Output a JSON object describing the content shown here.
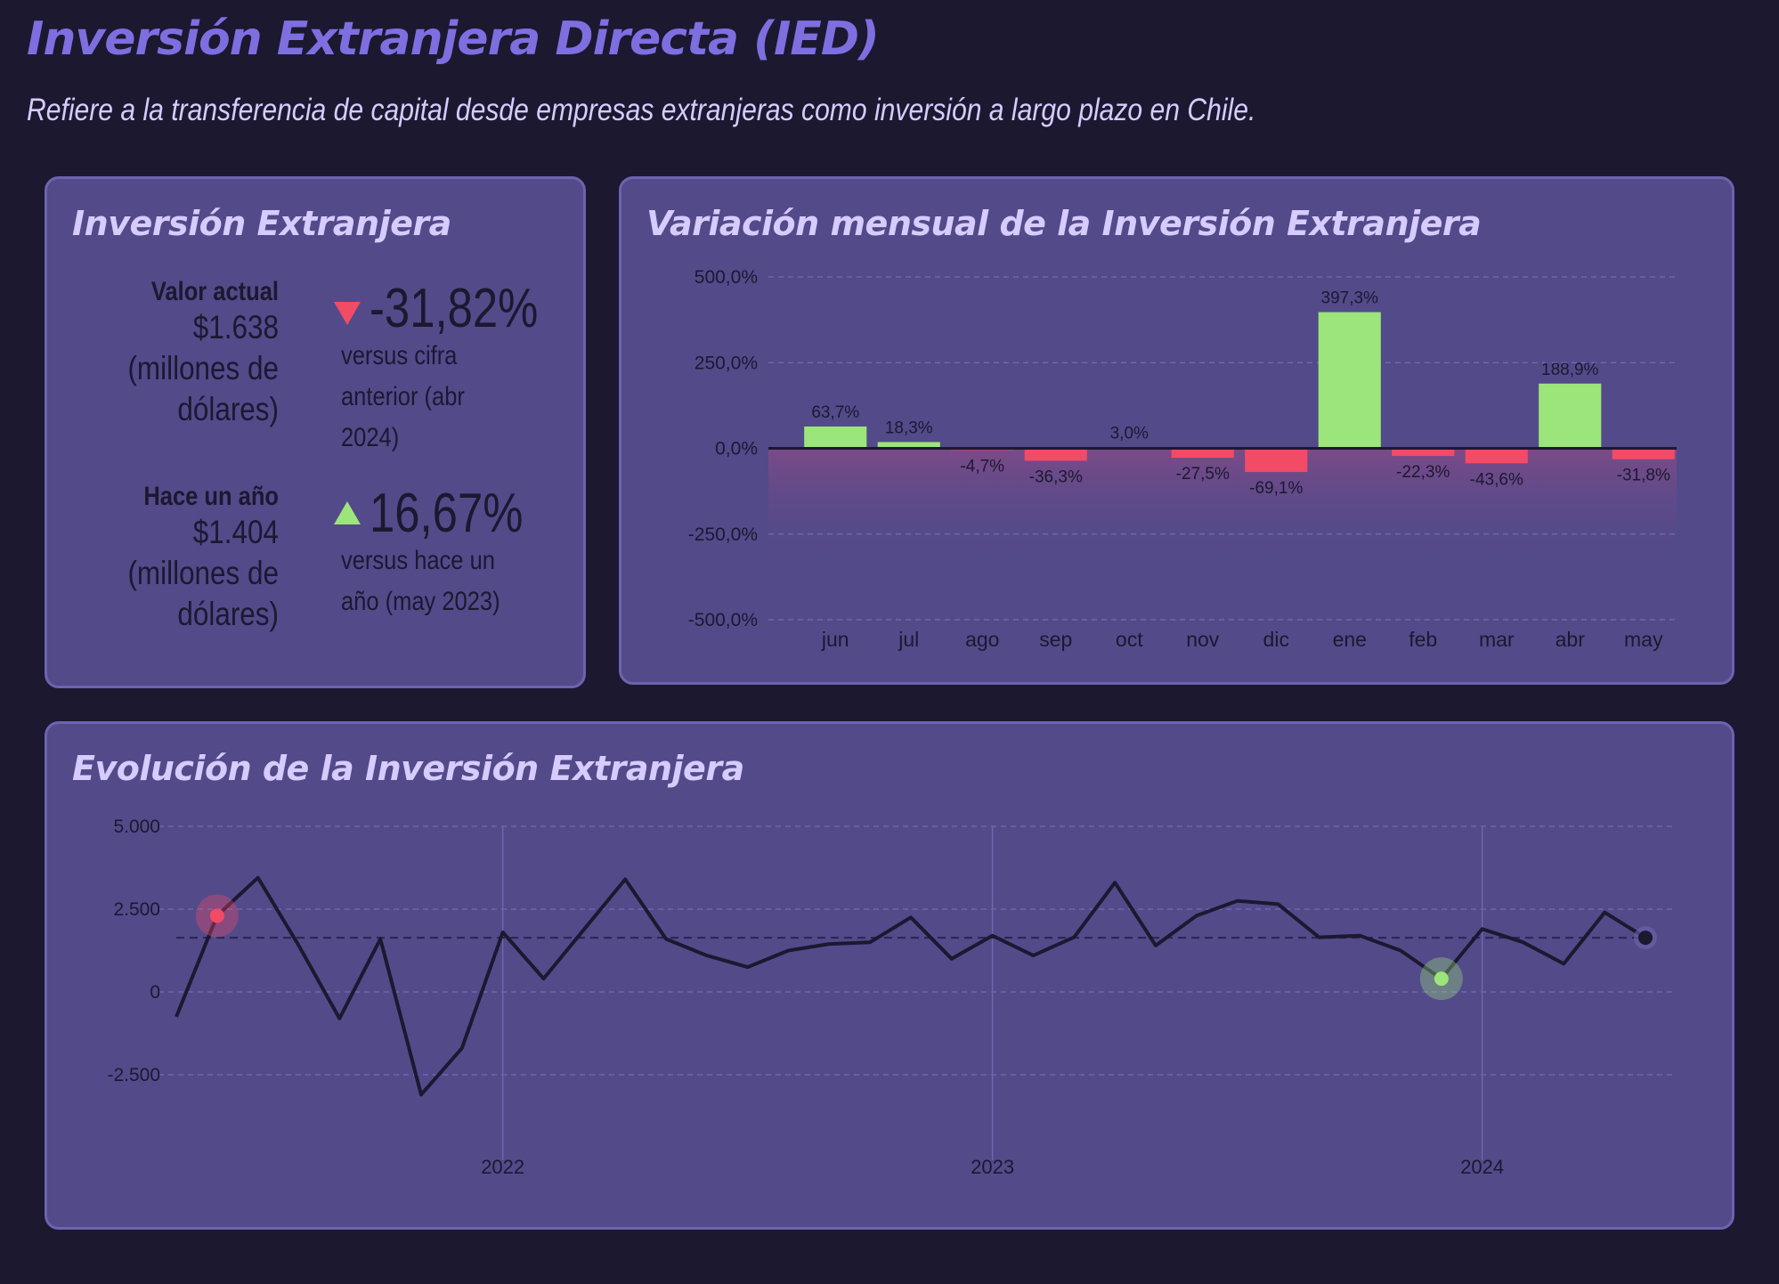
{
  "header": {
    "title": "Inversión Extranjera Directa (IED)",
    "subtitle": "Refiere a la transferencia de capital desde empresas extranjeras como inversión a largo plazo en Chile."
  },
  "kpi_panel": {
    "title": "Inversión Extranjera",
    "current": {
      "label": "Valor actual",
      "value_lines": [
        "$1.638",
        "(millones de",
        "dólares)"
      ],
      "change": "-31,82%",
      "direction": "down",
      "note": "versus cifra anterior (abr 2024)"
    },
    "year_ago": {
      "label": "Hace un año",
      "value_lines": [
        "$1.404",
        "(millones de",
        "dólares)"
      ],
      "change": "16,67%",
      "direction": "up",
      "note": "versus hace un año (may 2023)"
    }
  },
  "colors": {
    "positive": "#9be57a",
    "negative": "#f24b66",
    "line": "#1c1830",
    "panel": "#534a8a",
    "title_accent": "#7d6fe0"
  },
  "chart_data": [
    {
      "type": "bar",
      "title": "Variación mensual de la Inversión Extranjera",
      "categories": [
        "jun",
        "jul",
        "ago",
        "sep",
        "oct",
        "nov",
        "dic",
        "ene",
        "feb",
        "mar",
        "abr",
        "may"
      ],
      "values": [
        63.7,
        18.3,
        -4.7,
        -36.3,
        3.0,
        -27.5,
        -69.1,
        397.3,
        -22.3,
        -43.6,
        188.9,
        -31.8
      ],
      "data_labels": [
        "63,7%",
        "18,3%",
        "-4,7%",
        "-36,3%",
        "3,0%",
        "-27,5%",
        "-69,1%",
        "397,3%",
        "-22,3%",
        "-43,6%",
        "188,9%",
        "-31,8%"
      ],
      "ylim": [
        -500,
        500
      ],
      "yticks": [
        500,
        250,
        0,
        -250,
        -500
      ],
      "ytick_labels": [
        "500,0%",
        "250,0%",
        "0,0%",
        "-250,0%",
        "-500,0%"
      ],
      "grid": true,
      "xlabel": "",
      "ylabel": ""
    },
    {
      "type": "line",
      "title": "Evolución de la Inversión Extranjera",
      "x": [
        "2021-06",
        "2021-07",
        "2021-08",
        "2021-09",
        "2021-10",
        "2021-11",
        "2021-12",
        "2022-01",
        "2022-02",
        "2022-03",
        "2022-04",
        "2022-05",
        "2022-06",
        "2022-07",
        "2022-08",
        "2022-09",
        "2022-10",
        "2022-11",
        "2022-12",
        "2023-01",
        "2023-02",
        "2023-03",
        "2023-04",
        "2023-05",
        "2023-06",
        "2023-07",
        "2023-08",
        "2023-09",
        "2023-10",
        "2023-11",
        "2023-12",
        "2024-01",
        "2024-02",
        "2024-03",
        "2024-04",
        "2024-05"
      ],
      "values": [
        -750,
        2300,
        3450,
        1400,
        -800,
        1600,
        -3100,
        -1700,
        1800,
        400,
        1900,
        3400,
        1600,
        1100,
        750,
        1250,
        1450,
        1500,
        2250,
        1000,
        1700,
        1100,
        1650,
        3300,
        1400,
        2300,
        2750,
        2650,
        1650,
        1700,
        1250,
        400,
        1900,
        1500,
        850,
        2400,
        1638
      ],
      "reference_value": 1638,
      "highlight_min_index": 1,
      "highlight_year_ago_index": 31,
      "highlight_last_index": 36,
      "ylim": [
        -4000,
        5000
      ],
      "yticks": [
        5000,
        2500,
        0,
        -2500
      ],
      "ytick_labels": [
        "5.000",
        "2.500",
        "0",
        "-2.500"
      ],
      "year_ticks": [
        {
          "label": "2022",
          "x": "2022-01"
        },
        {
          "label": "2023",
          "x": "2023-01"
        },
        {
          "label": "2024",
          "x": "2024-01"
        }
      ],
      "grid": true,
      "xlabel": "",
      "ylabel": ""
    }
  ]
}
